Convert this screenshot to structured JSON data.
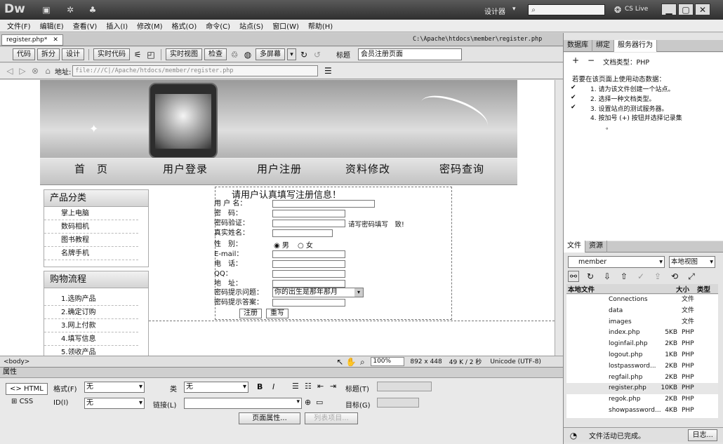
{
  "app": {
    "logo": "Dw",
    "designer": "设计器",
    "search_placeholder": "",
    "cslive": "CS Live"
  },
  "menu": [
    "文件(F)",
    "编辑(E)",
    "查看(V)",
    "插入(I)",
    "修改(M)",
    "格式(O)",
    "命令(C)",
    "站点(S)",
    "窗口(W)",
    "帮助(H)"
  ],
  "doc": {
    "tab": "register.php*",
    "path": "C:\\Apache\\htdocs\\member\\register.php"
  },
  "toolbar": {
    "code": "代码",
    "split": "拆分",
    "design": "设计",
    "live_code": "实时代码",
    "live_view": "实时视图",
    "inspect": "检查",
    "multiscreen": "多屏幕",
    "title_label": "标题",
    "title_value": "会员注册页面"
  },
  "address": {
    "label": "地址:",
    "value": "file:///C|/Apache/htdocs/member/register.php"
  },
  "page": {
    "nav": [
      "首　页",
      "用户登录",
      "用户注册",
      "资料修改",
      "密码查询"
    ],
    "side1_title": "产品分类",
    "side1": [
      "掌上电脑",
      "数码相机",
      "图书教程",
      "名牌手机"
    ],
    "side2_title": "购物流程",
    "side2": [
      "1.选购产品",
      "2.确定订购",
      "3.网上付款",
      "4.填写信息",
      "5.领收产品"
    ],
    "form_title": "请用户认真填写注册信息！",
    "labels": [
      "用 户 名：",
      "密　码：",
      "密码验证：",
      "真实姓名：",
      "性　别：",
      "E-mail：",
      "电　话：",
      "QQ：",
      "地　址：",
      "密码提示问题：",
      "密码提示答案："
    ],
    "pwd_hint": "请写密码填写　致!",
    "male": "男",
    "female": "女",
    "question": "你的出生是那年那月",
    "submit": "注册",
    "reset": "重写"
  },
  "status": {
    "tag": "<body>",
    "zoom": "100%",
    "size": "892 x 448",
    "weight": "49 K / 2 秒",
    "encoding": "Unicode (UTF-8)"
  },
  "props": {
    "title": "属性",
    "html": "HTML",
    "css": "CSS",
    "format_label": "格式(F)",
    "format_value": "无",
    "class_label": "类",
    "class_value": "无",
    "id_label": "ID(I)",
    "id_value": "无",
    "link_label": "链接(L)",
    "heading_label": "标题(T)",
    "target_label": "目标(G)",
    "page_props": "页面属性...",
    "list_item": "列表项目..."
  },
  "panel": {
    "tabs": [
      "数据库",
      "绑定",
      "服务器行为"
    ],
    "doc_type": "文档类型：PHP",
    "intro": "若要在该页面上使用动态数据：",
    "steps": [
      "1. 请为该文件创建一个站点。",
      "2. 选择一种文档类型。",
      "3. 设置站点的测试服务器。",
      "4. 按加号 (+) 按钮并选择记录集"
    ],
    "step_tail": "。",
    "file_tabs": [
      "文件",
      "资源"
    ],
    "site": "member",
    "view": "本地视图",
    "cols": [
      "本地文件",
      "大小",
      "类型"
    ],
    "files": [
      {
        "n": "Connections",
        "s": "",
        "t": "文件"
      },
      {
        "n": "data",
        "s": "",
        "t": "文件"
      },
      {
        "n": "images",
        "s": "",
        "t": "文件"
      },
      {
        "n": "index.php",
        "s": "5KB",
        "t": "PHP"
      },
      {
        "n": "loginfail.php",
        "s": "2KB",
        "t": "PHP"
      },
      {
        "n": "logout.php",
        "s": "1KB",
        "t": "PHP"
      },
      {
        "n": "lostpassword...",
        "s": "2KB",
        "t": "PHP"
      },
      {
        "n": "regfail.php",
        "s": "2KB",
        "t": "PHP"
      },
      {
        "n": "register.php",
        "s": "10KB",
        "t": "PHP"
      },
      {
        "n": "regok.php",
        "s": "2KB",
        "t": "PHP"
      },
      {
        "n": "showpassword...",
        "s": "4KB",
        "t": "PHP"
      }
    ],
    "status": "文件活动已完成。",
    "log": "日志..."
  }
}
